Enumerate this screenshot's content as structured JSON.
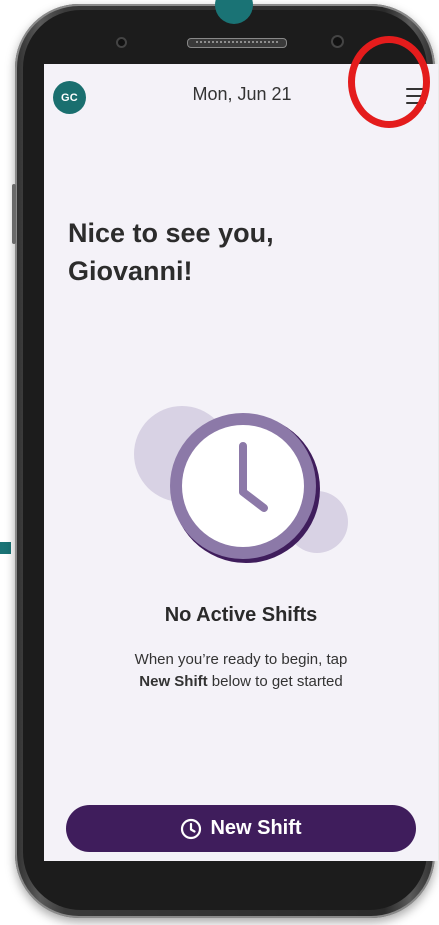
{
  "header": {
    "avatar_initials": "GC",
    "date": "Mon, Jun 21",
    "menu_icon": "hamburger-menu-icon"
  },
  "main": {
    "greeting_line1": "Nice to see you,",
    "greeting_line2": "Giovanni!",
    "empty_state": {
      "icon": "clock-icon",
      "title": "No Active Shifts",
      "desc_prefix": "When you’re ready to begin, tap",
      "desc_bold": "New Shift",
      "desc_suffix": "below to get started"
    }
  },
  "footer": {
    "new_shift_label": "New Shift",
    "new_shift_icon": "clock-icon"
  },
  "colors": {
    "accent_teal": "#1a7375",
    "primary_purple": "#3f1d5c",
    "clock_lavender": "#8c79a8",
    "highlight_red": "#e41c1c"
  }
}
